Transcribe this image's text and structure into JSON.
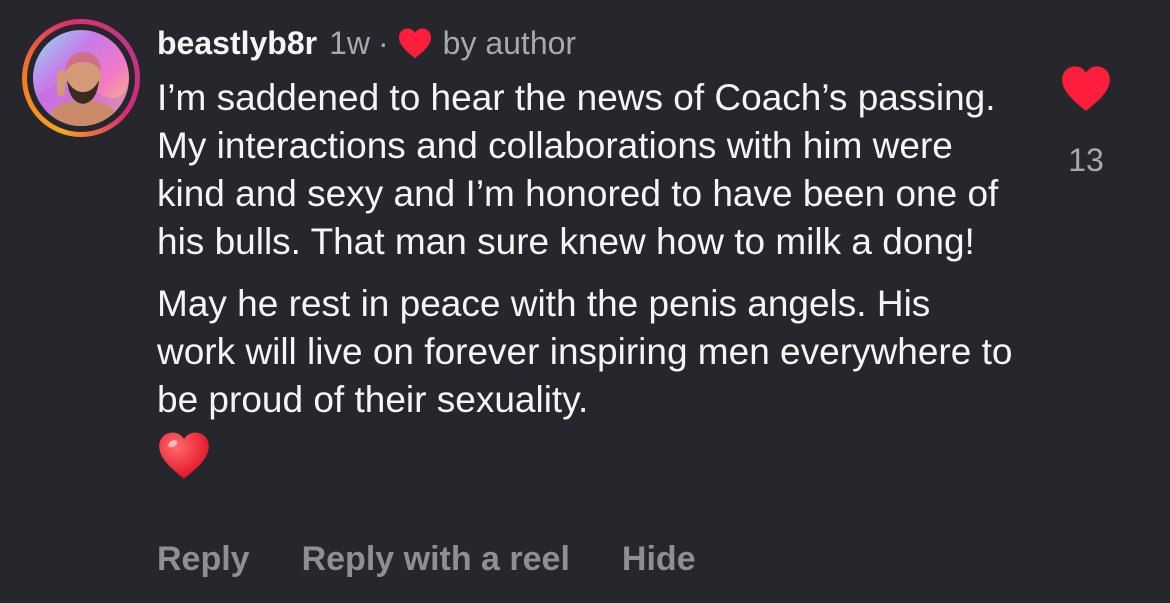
{
  "comment": {
    "username": "beastlyb8r",
    "age": "1w",
    "separator": "·",
    "by_author": "by author",
    "paragraphs": [
      "I’m saddened to hear the news of Coach’s passing. My interactions and collaborations with him were kind and sexy and I’m honored to have been one of his bulls. That man sure knew how to milk a dong!",
      "May he rest in peace with the penis angels. His work will live on forever inspiring men everywhere to be proud of their sexuality."
    ],
    "emoji": "red-heart",
    "like_count": "13",
    "liked": true
  },
  "actions": {
    "reply": "Reply",
    "reply_with_reel": "Reply with a reel",
    "hide": "Hide"
  },
  "colors": {
    "background": "#25272c",
    "heart_red": "#ff1f3d",
    "muted_text": "#a8a8ad"
  }
}
